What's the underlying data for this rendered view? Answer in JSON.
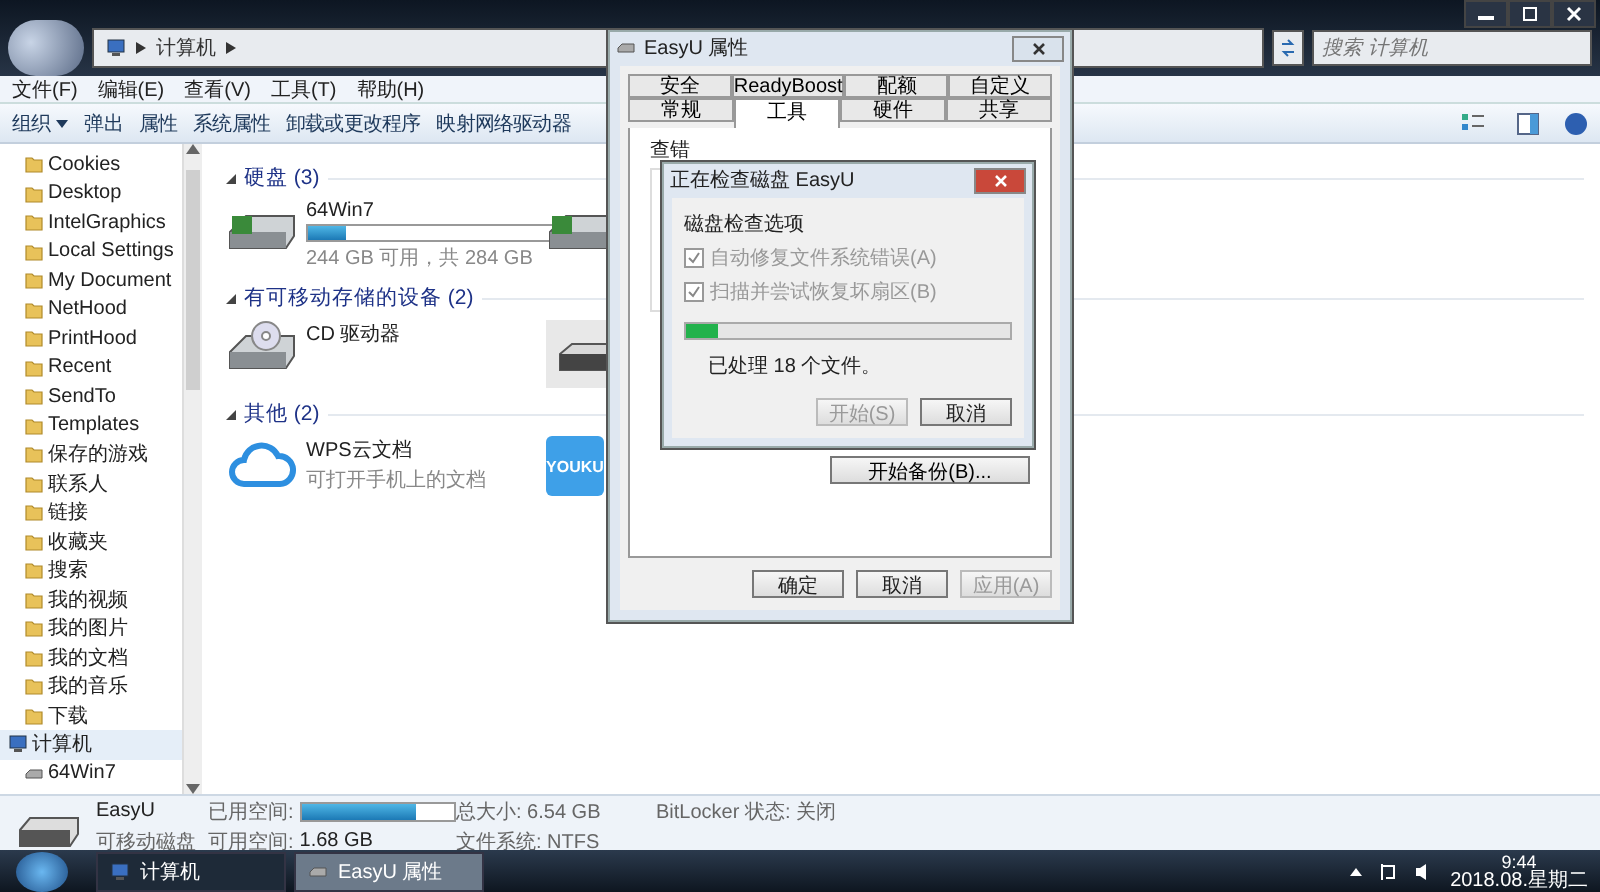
{
  "explorer": {
    "address": "计算机",
    "search": {
      "placeholder": "搜索 计算机"
    },
    "menu": [
      "文件(F)",
      "编辑(E)",
      "查看(V)",
      "工具(T)",
      "帮助(H)"
    ],
    "toolbar": [
      {
        "label": "组织",
        "kind": "dropdown"
      },
      {
        "label": "弹出",
        "kind": "plain"
      },
      {
        "label": "属性",
        "kind": "plain"
      },
      {
        "label": "系统属性",
        "kind": "plain"
      },
      {
        "label": "卸载或更改程序",
        "kind": "plain"
      },
      {
        "label": "映射网络驱动器",
        "kind": "plain"
      }
    ],
    "nav": [
      {
        "label": "Cookies",
        "kind": "folder",
        "selected": false
      },
      {
        "label": "Desktop",
        "kind": "folder",
        "selected": false
      },
      {
        "label": "IntelGraphics",
        "kind": "folder",
        "selected": false
      },
      {
        "label": "Local Settings",
        "kind": "folder",
        "selected": false
      },
      {
        "label": "My Document",
        "kind": "folder",
        "selected": false
      },
      {
        "label": "NetHood",
        "kind": "folder",
        "selected": false
      },
      {
        "label": "PrintHood",
        "kind": "folder",
        "selected": false
      },
      {
        "label": "Recent",
        "kind": "folder",
        "selected": false
      },
      {
        "label": "SendTo",
        "kind": "folder",
        "selected": false
      },
      {
        "label": "Templates",
        "kind": "folder",
        "selected": false
      },
      {
        "label": "保存的游戏",
        "kind": "folder",
        "selected": false
      },
      {
        "label": "联系人",
        "kind": "folder",
        "selected": false
      },
      {
        "label": "链接",
        "kind": "folder",
        "selected": false
      },
      {
        "label": "收藏夹",
        "kind": "folder",
        "selected": false
      },
      {
        "label": "搜索",
        "kind": "folder",
        "selected": false
      },
      {
        "label": "我的视频",
        "kind": "folder",
        "selected": false
      },
      {
        "label": "我的图片",
        "kind": "folder",
        "selected": false
      },
      {
        "label": "我的文档",
        "kind": "folder",
        "selected": false
      },
      {
        "label": "我的音乐",
        "kind": "folder",
        "selected": false
      },
      {
        "label": "下载",
        "kind": "folder",
        "selected": false
      },
      {
        "label": "计算机",
        "kind": "computer",
        "selected": true
      },
      {
        "label": "64Win7",
        "kind": "drive",
        "selected": false
      }
    ],
    "groups": [
      {
        "title": "硬盘 (3)",
        "items": [
          {
            "kind": "hdd",
            "name": "64Win7",
            "level": 0.14,
            "caption": "244 GB 可用，共 284 GB"
          },
          {
            "kind": "hdd"
          }
        ]
      },
      {
        "title": "有可移动存储的设备 (2)",
        "items": [
          {
            "kind": "cd",
            "name": "CD 驱动器"
          },
          {
            "kind": "usb"
          }
        ]
      },
      {
        "title": "其他 (2)",
        "items": [
          {
            "kind": "cloud",
            "name": "WPS云文档",
            "caption": "可打开手机上的文档"
          },
          {
            "kind": "video-app",
            "name": "YOUKU"
          }
        ]
      }
    ],
    "details": {
      "name": "EasyU",
      "type": "可移动磁盘",
      "used_label": "已用空间:",
      "level": 0.75,
      "free_label": "可用空间:",
      "free": "1.68 GB",
      "total": "总大小: 6.54 GB",
      "fs": "文件系统: NTFS",
      "bitlocker": "BitLocker 状态: 关闭"
    }
  },
  "properties": {
    "title": "EasyU 属性",
    "tab_rows": [
      [
        {
          "label": "安全",
          "selected": false
        },
        {
          "label": "ReadyBoost",
          "selected": false
        },
        {
          "label": "配额",
          "selected": false
        },
        {
          "label": "自定义",
          "selected": false
        }
      ],
      [
        {
          "label": "常规",
          "selected": false
        },
        {
          "label": "工具",
          "selected": true
        },
        {
          "label": "硬件",
          "selected": false
        },
        {
          "label": "共享",
          "selected": false
        }
      ]
    ],
    "group_title": "查错",
    "backup_button": "开始备份(B)...",
    "buttons": [
      {
        "label": "确定",
        "disabled": false
      },
      {
        "label": "取消",
        "disabled": false
      },
      {
        "label": "应用(A)",
        "disabled": true
      }
    ]
  },
  "check_dialog": {
    "title": "正在检查磁盘 EasyU",
    "group_title": "磁盘检查选项",
    "options": [
      {
        "label": "自动修复文件系统错误(A)",
        "checked": true,
        "disabled": true
      },
      {
        "label": "扫描并尝试恢复坏扇区(B)",
        "checked": true,
        "disabled": true
      }
    ],
    "level": 0.1,
    "status": "已处理 18 个文件。",
    "buttons": [
      {
        "label": "开始(S)",
        "disabled": true
      },
      {
        "label": "取消",
        "disabled": false
      }
    ]
  },
  "taskbar": {
    "items": [
      {
        "label": "计算机",
        "kind": "computer",
        "selected": false
      },
      {
        "label": "EasyU 属性",
        "kind": "drive",
        "selected": true
      }
    ],
    "time": "9:44",
    "date": "2018.08.星期二"
  }
}
